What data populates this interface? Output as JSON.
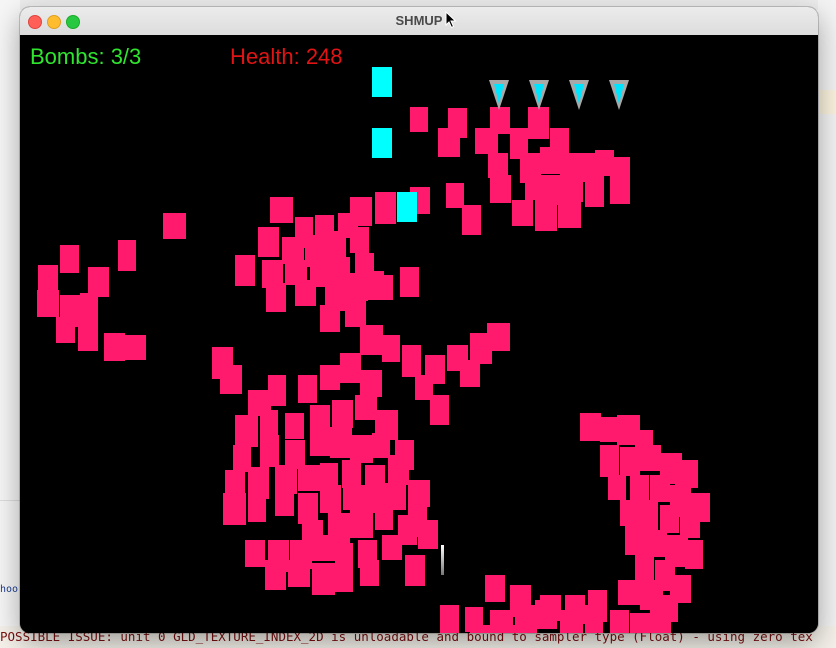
{
  "window": {
    "title": "SHMUP"
  },
  "hud": {
    "bombs_label": "Bombs: 3/3",
    "health_label": "Health: 248",
    "bombs_color": "#2fe62f",
    "health_color": "#e01414"
  },
  "game": {
    "enemy_count": 4,
    "enemy_color": "#a8a8a8",
    "enemy_accent": "#00e5ff",
    "bullet_color": "#00ffff",
    "splatter_color": "#ff1a6e",
    "background": "#000000"
  },
  "console": {
    "message": "POSSIBLE ISSUE: unit 0 GLD_TEXTURE_INDEX_2D is unloadable and bound to sampler type (Float) - using zero tex"
  },
  "background_app": {
    "left_snippet": "hoo"
  },
  "icons": {
    "close": "close-icon",
    "minimize": "minimize-icon",
    "maximize": "maximize-icon",
    "cursor": "mouse-cursor-icon"
  }
}
